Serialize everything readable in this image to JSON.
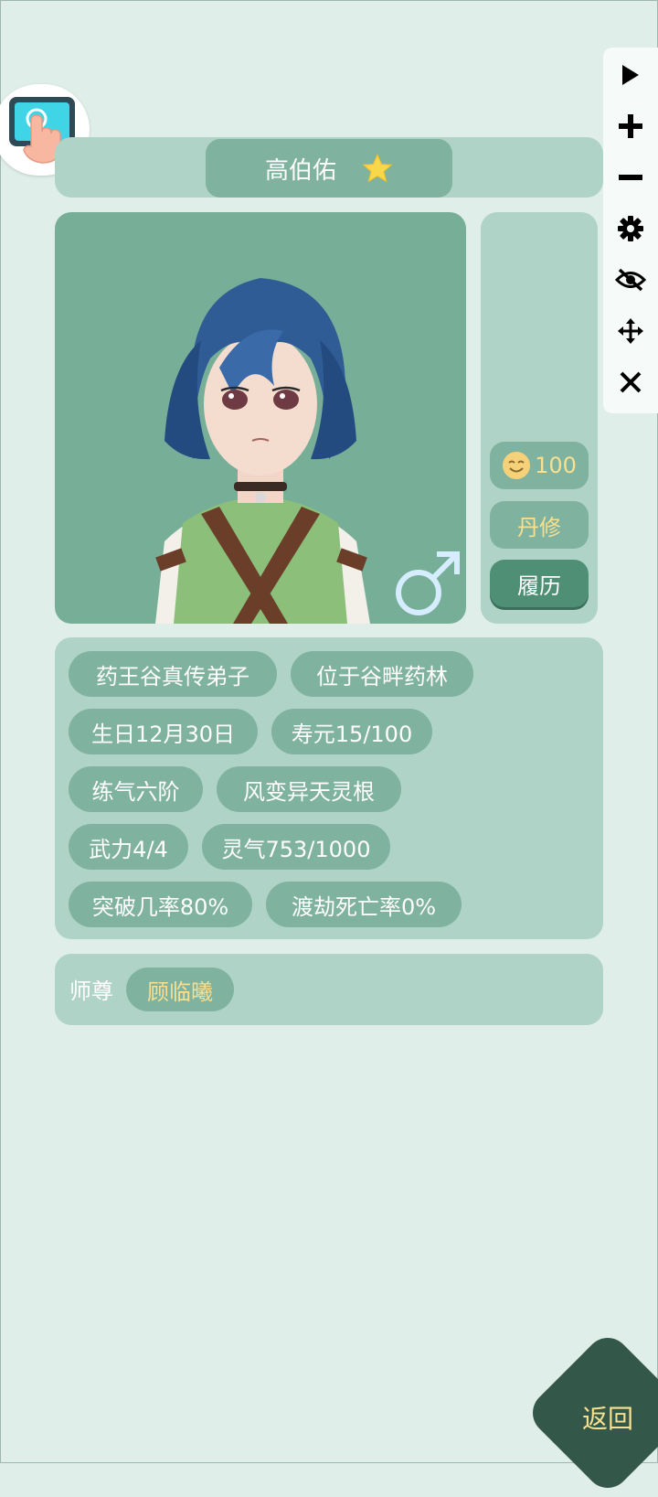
{
  "character": {
    "name": "高伯佑",
    "favorite_icon": "star-icon",
    "gender_icon": "male-icon"
  },
  "side": {
    "mood_value": "100",
    "mood_icon": "smiling-face-icon",
    "role": "丹修",
    "history_label": "履历"
  },
  "info_tags": [
    "药王谷真传弟子",
    "位于谷畔药林",
    "生日12月30日",
    "寿元15/100",
    "练气六阶",
    "风变异天灵根",
    "武力4/4",
    "灵气753/1000",
    "突破几率80%",
    "渡劫死亡率0%"
  ],
  "mentor": {
    "label": "师尊",
    "name": "顾临曦"
  },
  "toolbar": {
    "items": [
      "play-icon",
      "plus-icon",
      "minus-icon",
      "gear-icon",
      "eye-slash-icon",
      "move-icon",
      "close-icon"
    ]
  },
  "return_label": "返回",
  "colors": {
    "background": "#dfeee9",
    "panel": "#afd3c7",
    "pill": "#7fb29f",
    "accent_text": "#f7e08f",
    "dark_button": "#33584a"
  }
}
